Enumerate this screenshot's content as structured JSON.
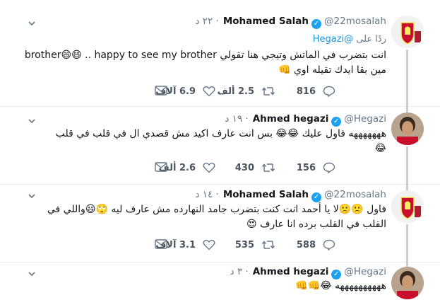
{
  "tweets": [
    {
      "name": "Mohamed Salah",
      "handle": "@22mosalah",
      "time": "٢٢ د",
      "reply_label": "ردًا على",
      "reply_to": "@Hegazi",
      "text_line1": "انت بتضرب في الماتش وتيجي هنا تقولي brother😄😄 .. happy to see my brother",
      "text_line2": "مين بقا ايدك تقيله اوي 👊",
      "replies": "816",
      "retweets": "2.5 ألف",
      "likes": "6.9 آلاف",
      "avatar": "liverpool-crest-avatar"
    },
    {
      "name": "Ahmed hegazi",
      "handle": "@Hegazi",
      "time": "١٩ د",
      "text_line1": "هههههههه فاول عليك 😂😂 بس انت عارف اكيد مش قصدي ال في قلب في قلب",
      "text_line2": "😂",
      "replies": "156",
      "retweets": "430",
      "likes": "2.6 ألف",
      "avatar": "player-portrait-avatar"
    },
    {
      "name": "Mohamed Salah",
      "handle": "@22mosalah",
      "time": "١٤ د",
      "text_line1": "فاول 🙁🙁لا يا أحمد انت كنت بتضرب جامد النهارده مش عارف ليه 🙄😃واللي في",
      "text_line2": "القلب في القلب برده انا عارف 😍",
      "replies": "588",
      "retweets": "535",
      "likes": "3.1 آلاف",
      "avatar": "liverpool-crest-avatar"
    },
    {
      "name": "Ahmed hegazi",
      "handle": "@Hegazi",
      "time": "٣ د",
      "text_line1": "ههههههههههه 😂👊👊",
      "avatar": "player-portrait-avatar"
    }
  ],
  "colors": {
    "verified": "#1da1f2",
    "mention": "#1b95e0",
    "muted": "#657786",
    "thread": "#c4cfd6"
  }
}
